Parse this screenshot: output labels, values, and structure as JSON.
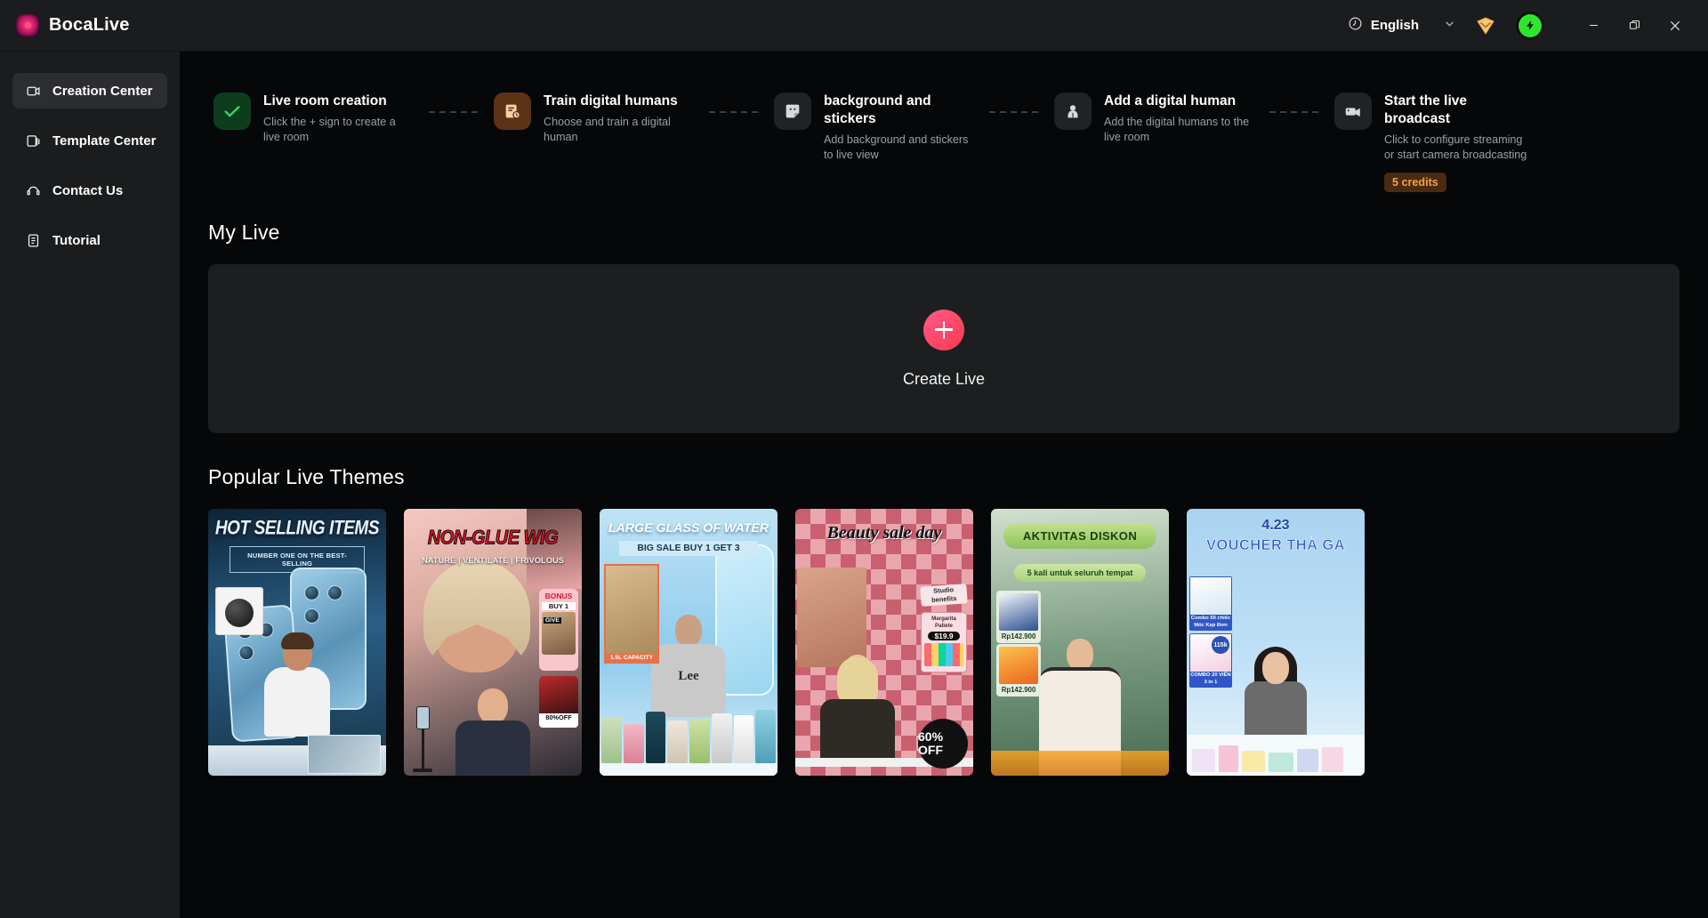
{
  "titlebar": {
    "app_name": "BocaLive",
    "language": "English",
    "icons": {
      "globe": "globe-icon",
      "chevron": "chevron-down-icon",
      "gem": "diamond-gem-icon",
      "avatar": "user-avatar-lightning-icon",
      "minimize": "minimize-icon",
      "maximize": "maximize-restore-icon",
      "close": "close-icon"
    }
  },
  "sidebar": {
    "items": [
      {
        "label": "Creation Center",
        "icon": "video-card-icon",
        "active": true
      },
      {
        "label": "Template Center",
        "icon": "template-cards-icon",
        "active": false
      },
      {
        "label": "Contact Us",
        "icon": "headset-icon",
        "active": false
      },
      {
        "label": "Tutorial",
        "icon": "document-list-icon",
        "active": false
      }
    ]
  },
  "steps": [
    {
      "title": "Live room creation",
      "desc": "Click the + sign to create a live room",
      "icon": "check-icon",
      "state": "done",
      "badge": null
    },
    {
      "title": "Train digital humans",
      "desc": "Choose and train a digital human",
      "icon": "train-human-icon",
      "state": "active",
      "badge": null
    },
    {
      "title": "background and stickers",
      "desc": "Add background and stickers to live view",
      "icon": "sticker-icon",
      "state": "idle",
      "badge": null
    },
    {
      "title": "Add a digital human",
      "desc": "Add the digital humans to the live room",
      "icon": "person-icon",
      "state": "idle",
      "badge": null
    },
    {
      "title": "Start the live broadcast",
      "desc": "Click to configure streaming or start camera broadcasting",
      "icon": "video-camera-icon",
      "state": "idle",
      "badge": "5 credits"
    }
  ],
  "my_live": {
    "section_title": "My Live",
    "create_label": "Create Live",
    "plus_icon": "plus-icon"
  },
  "themes": {
    "section_title": "Popular Live Themes",
    "cards": [
      {
        "id": "hot-selling-items",
        "title": "HOT SELLING ITEMS",
        "subtitle": "NUMBER ONE ON THE BEST-SELLING"
      },
      {
        "id": "non-glue-wig",
        "title": "NON-GLUE WIG",
        "subtitle": "NATURE | VENTILATE | FRIVOLOUS",
        "badges": [
          "BONUS",
          "BUY 1",
          "GIVE",
          "80%OFF"
        ]
      },
      {
        "id": "large-glass-of-water",
        "title": "LARGE GLASS OF WATER",
        "subtitle": "BIG SALE BUY 1 GET 3",
        "badges": [
          "1.5L CAPACITY"
        ]
      },
      {
        "id": "beauty-sale-day",
        "title": "Beauty sale day",
        "badges": [
          "Studio benefits",
          "Margarita Pallete",
          "$19.9",
          "60% OFF"
        ]
      },
      {
        "id": "aktivitas-diskon",
        "title": "AKTIVITAS DISKON",
        "subtitle": "5 kali untuk seluruh tempat",
        "badges": [
          "Rp142.900",
          "Rp142.900"
        ]
      },
      {
        "id": "voucher-tha-ga",
        "title": "4.23",
        "subtitle": "VOUCHER THẢ GA",
        "badges": [
          "Combo 50 chiếc Móc Kẹp Đơn",
          "115k",
          "COMBO 20 VIÊN 3 in 1"
        ]
      }
    ]
  },
  "colors": {
    "accent_pink": "#f83b4e",
    "credit_orange": "#f5a142",
    "sidebar_bg": "#1a1c1e",
    "main_bg": "#060708",
    "panel_bg": "#1c1e20"
  }
}
